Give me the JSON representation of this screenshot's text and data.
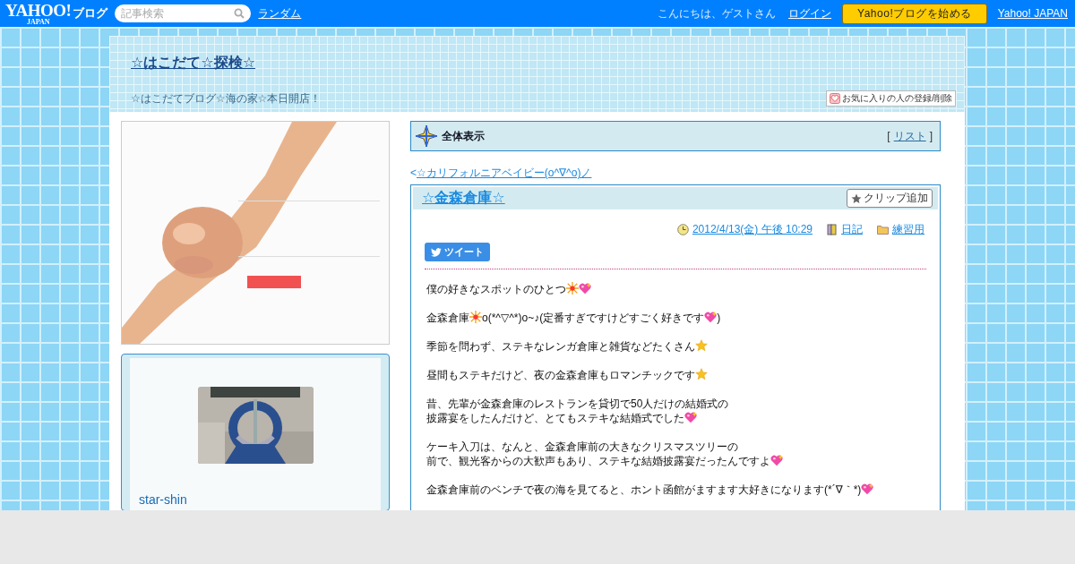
{
  "topbar": {
    "logo": "YAHOO!",
    "logo_sub": "JAPAN",
    "service": "ブログ",
    "search": {
      "placeholder": "記事検索"
    },
    "random_link": "ランダム",
    "greeting": "こんにちは、ゲストさん",
    "login_link": "ログイン",
    "start_button": "Yahoo!ブログを始める",
    "home_link": "Yahoo! JAPAN"
  },
  "blog": {
    "title": "☆はこだて☆探検☆",
    "description": "☆はこだてブログ☆海の家☆本日開店！",
    "favorite_button": "お気に入りの人の登録/削除"
  },
  "sidebar": {
    "profile": {
      "kind": "picture",
      "name": "star-shin"
    }
  },
  "main": {
    "section": {
      "title": "全体表示",
      "bracket_open": "[",
      "list_link": "リスト",
      "bracket_close": "]"
    },
    "prev": {
      "arrow": "<",
      "link": "☆カリフォルニアベイビー(o^∇^o)ノ"
    },
    "article": {
      "title": "☆金森倉庫☆",
      "clip_button": "クリップ追加",
      "date": "2012/4/13(金) 午後 10:29",
      "category": "日記",
      "folder": "練習用",
      "tweet_button": "ツイート",
      "paragraphs": [
        [
          {
            "kind": "text",
            "text": "僕の好きなスポットのひとつ"
          },
          {
            "kind": "sparkle"
          },
          {
            "kind": "heart"
          }
        ],
        [
          {
            "kind": "text",
            "text": "金森倉庫"
          },
          {
            "kind": "sparkle"
          },
          {
            "kind": "text",
            "text": "o(*^▽^*)o~♪(定番すぎですけどすごく好きです"
          },
          {
            "kind": "heart"
          },
          {
            "kind": "text",
            "text": ")"
          }
        ],
        [
          {
            "kind": "text",
            "text": "季節を問わず、ステキなレンガ倉庫と雑貨などたくさん"
          },
          {
            "kind": "star"
          }
        ],
        [
          {
            "kind": "text",
            "text": "昼間もステキだけど、夜の金森倉庫もロマンチックです"
          },
          {
            "kind": "star"
          }
        ],
        [
          {
            "kind": "text",
            "text": "昔、先輩が金森倉庫のレストランを貸切で50人だけの結婚式の"
          },
          {
            "kind": "break"
          },
          {
            "kind": "text",
            "text": "披露宴をしたんだけど、とてもステキな結婚式でした"
          },
          {
            "kind": "heart"
          }
        ],
        [
          {
            "kind": "text",
            "text": "ケーキ入刀は、なんと、金森倉庫前の大きなクリスマスツリーの"
          },
          {
            "kind": "break"
          },
          {
            "kind": "text",
            "text": "前で、観光客からの大歓声もあり、ステキな結婚披露宴だったんですよ"
          },
          {
            "kind": "heart"
          }
        ],
        [
          {
            "kind": "text",
            "text": "金森倉庫前のベンチで夜の海を見てると、ホント函館がますます大好きになります(*´∇｀*)"
          },
          {
            "kind": "heart"
          }
        ]
      ]
    }
  }
}
